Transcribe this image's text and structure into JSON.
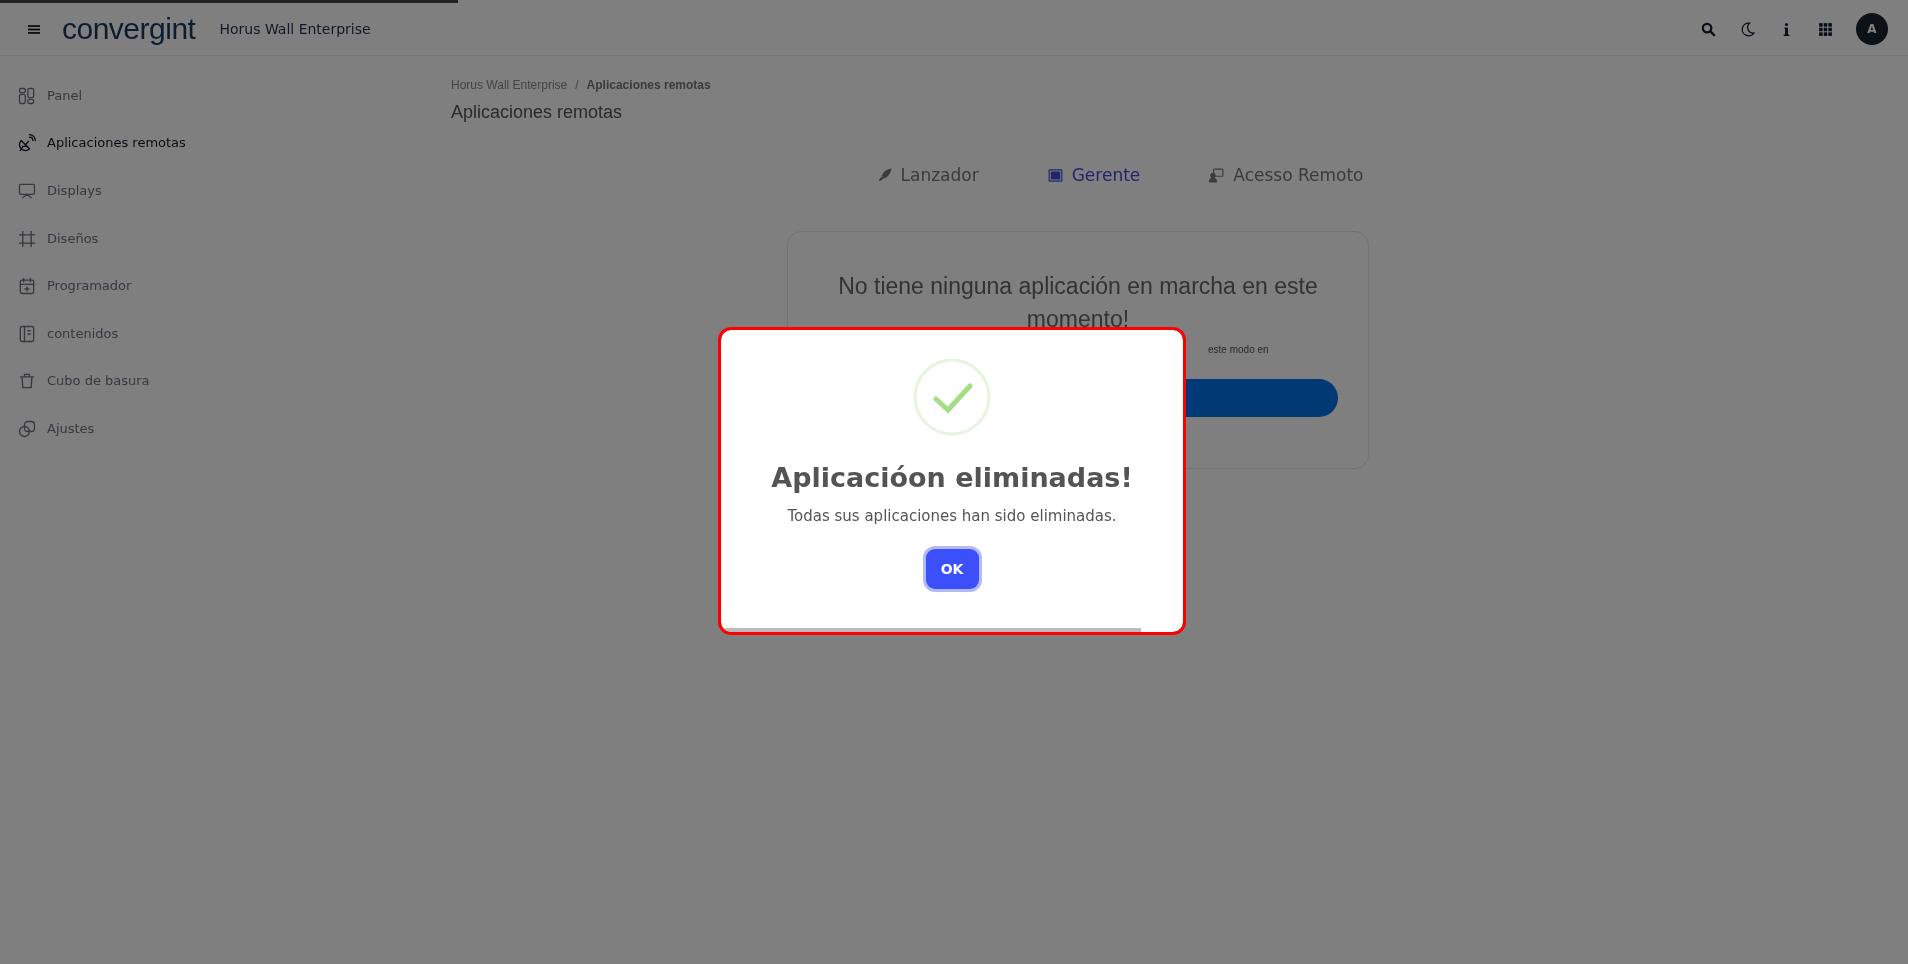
{
  "loading_bar": {
    "level": 0.24
  },
  "topbar": {
    "logo": "convergint",
    "app_title": "Horus Wall Enterprise",
    "avatar": "A"
  },
  "sidebar": {
    "items": [
      {
        "label": "Panel",
        "selected": false
      },
      {
        "label": "Aplicaciones remotas",
        "selected": true
      },
      {
        "label": "Displays",
        "selected": false
      },
      {
        "label": "Diseños",
        "selected": false
      },
      {
        "label": "Programador",
        "selected": false
      },
      {
        "label": "contenidos",
        "selected": false
      },
      {
        "label": "Cubo de basura",
        "selected": false
      },
      {
        "label": "Ajustes",
        "selected": false
      }
    ]
  },
  "breadcrumb": [
    "Horus Wall Enterprise",
    "/",
    "Aplicaciones remotas"
  ],
  "page_title": "Aplicaciones remotas",
  "tabs": [
    {
      "label": "Lanzador",
      "selected": false
    },
    {
      "label": "Gerente",
      "selected": true
    },
    {
      "label": "Acesso Remoto",
      "selected": false
    }
  ],
  "card": {
    "message": "No tiene ninguna aplicación en marcha en este momento!",
    "note": "este modo en"
  },
  "dialog": {
    "title": "Aplicacióon eliminadas!",
    "text": "Todas sus aplicaciones han sido eliminadas.",
    "button": "OK",
    "timer": {
      "level": 0.91
    }
  }
}
